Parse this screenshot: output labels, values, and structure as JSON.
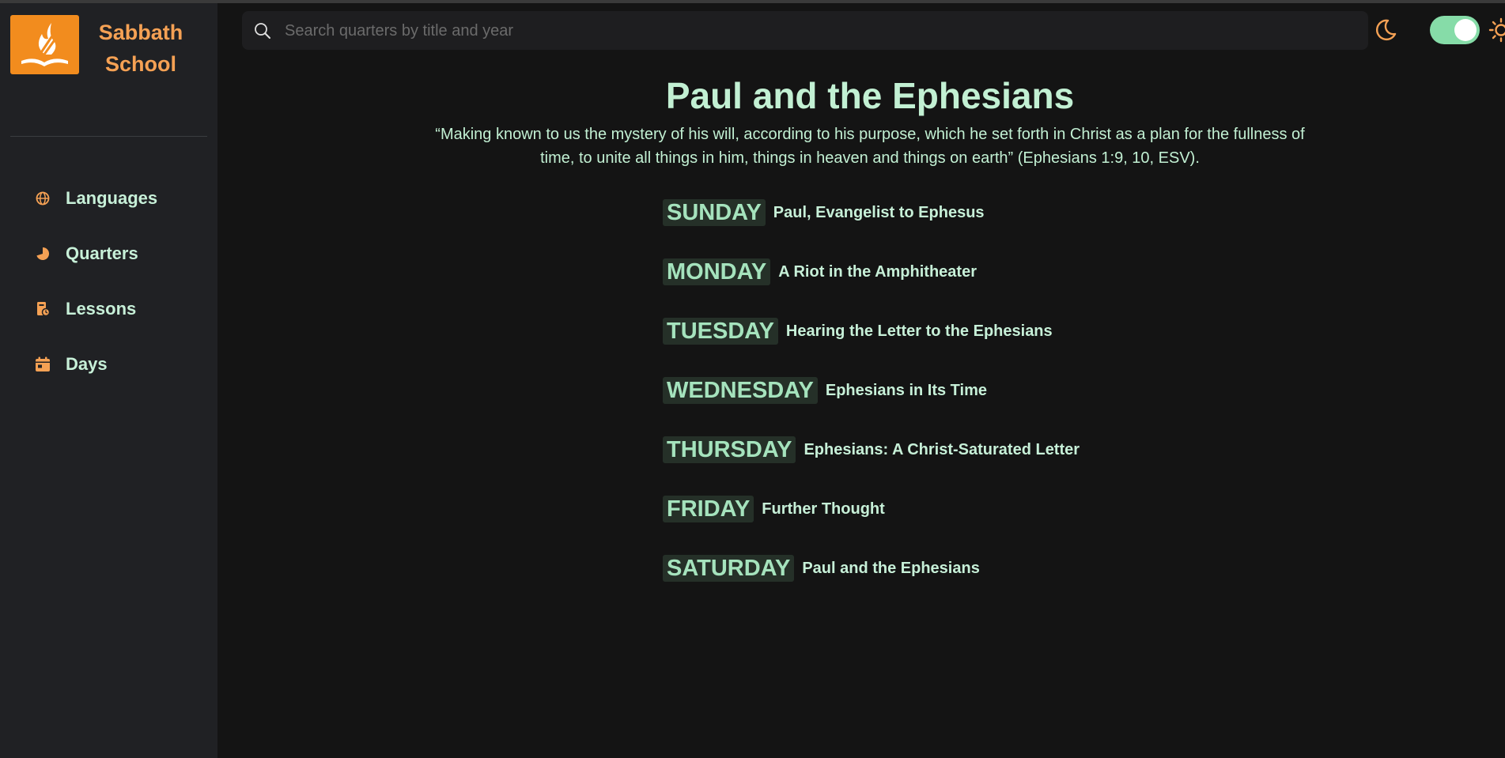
{
  "brand": {
    "line1": "Sabbath",
    "line2": "School"
  },
  "sidebar": {
    "items": [
      {
        "label": "Languages",
        "icon": "globe-icon"
      },
      {
        "label": "Quarters",
        "icon": "pie-chart-icon"
      },
      {
        "label": "Lessons",
        "icon": "lesson-book-icon"
      },
      {
        "label": "Days",
        "icon": "calendar-icon"
      }
    ]
  },
  "search": {
    "placeholder": "Search quarters by title and year"
  },
  "theme": {
    "dark_mode_enabled": true
  },
  "lesson": {
    "title": "Paul and the Ephesians",
    "verse": "“Making known to us the mystery of his will, according to his purpose, which he set forth in Christ as a plan for the fullness of time, to unite all things in him, things in heaven and things on earth” (Ephesians 1:9, 10, ESV).",
    "days": [
      {
        "day": "SUNDAY",
        "title": "Paul, Evangelist to Ephesus"
      },
      {
        "day": "MONDAY",
        "title": "A Riot in the Amphitheater"
      },
      {
        "day": "TUESDAY",
        "title": "Hearing the Letter to the Ephesians"
      },
      {
        "day": "WEDNESDAY",
        "title": "Ephesians in Its Time"
      },
      {
        "day": "THURSDAY",
        "title": "Ephesians: A Christ-Saturated Letter"
      },
      {
        "day": "FRIDAY",
        "title": "Further Thought"
      },
      {
        "day": "SATURDAY",
        "title": "Paul and the Ephesians"
      }
    ]
  },
  "colors": {
    "accent_orange": "#f28c1e",
    "mint_text": "#c2f0d3",
    "toggle_green": "#86dca8",
    "background": "#141414",
    "sidebar_bg": "#202124"
  }
}
